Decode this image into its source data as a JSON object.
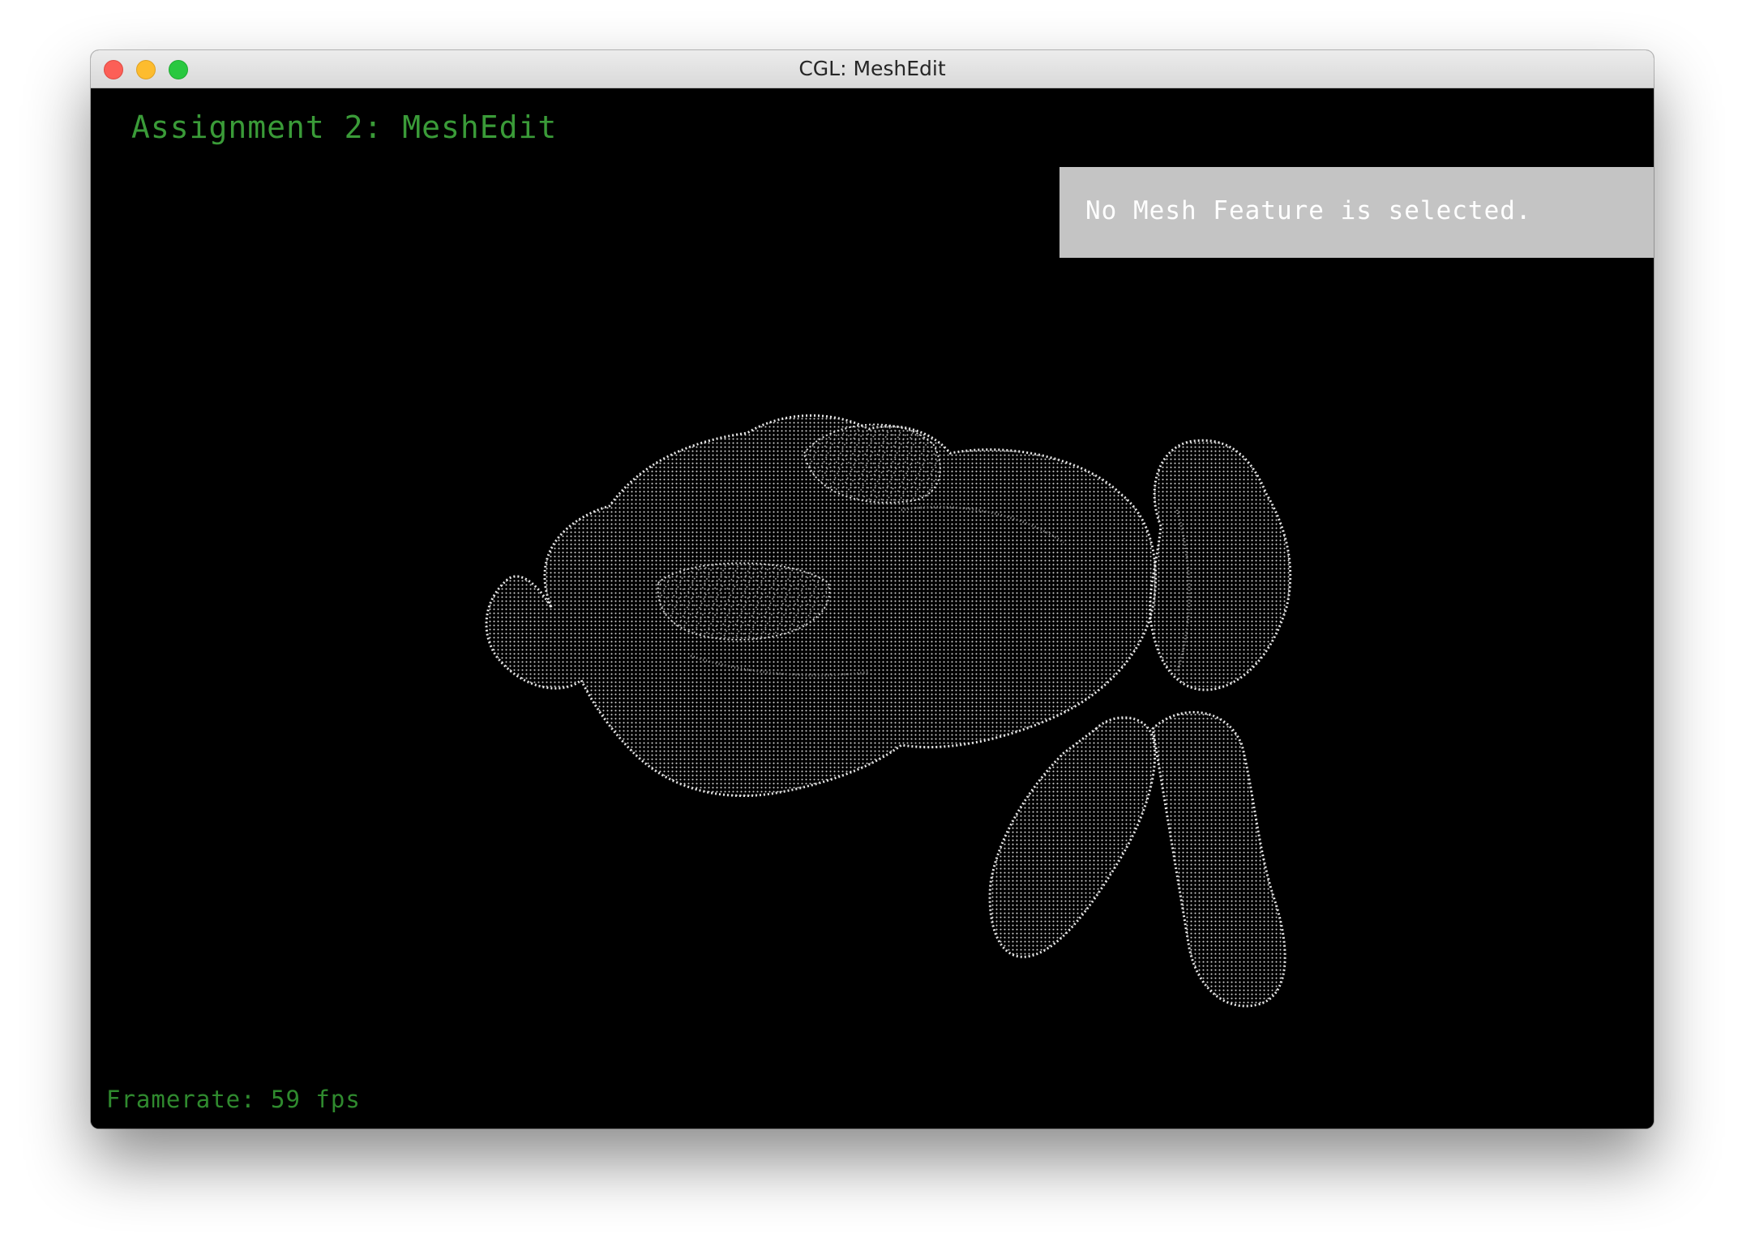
{
  "window": {
    "title": "CGL: MeshEdit"
  },
  "viewport": {
    "header": "Assignment 2: MeshEdit",
    "info_panel_text": "No Mesh Feature is selected.",
    "framerate_text": "Framerate: 59 fps",
    "mesh_icon": "bunny-point-cloud-mesh"
  },
  "colors": {
    "header_text": "#3a9b38",
    "framerate_text": "#2f8a2e",
    "panel_bg": "#c4c4c4",
    "panel_text": "#ffffff",
    "viewport_bg": "#000000",
    "mesh_points": "#d8d8d8"
  }
}
